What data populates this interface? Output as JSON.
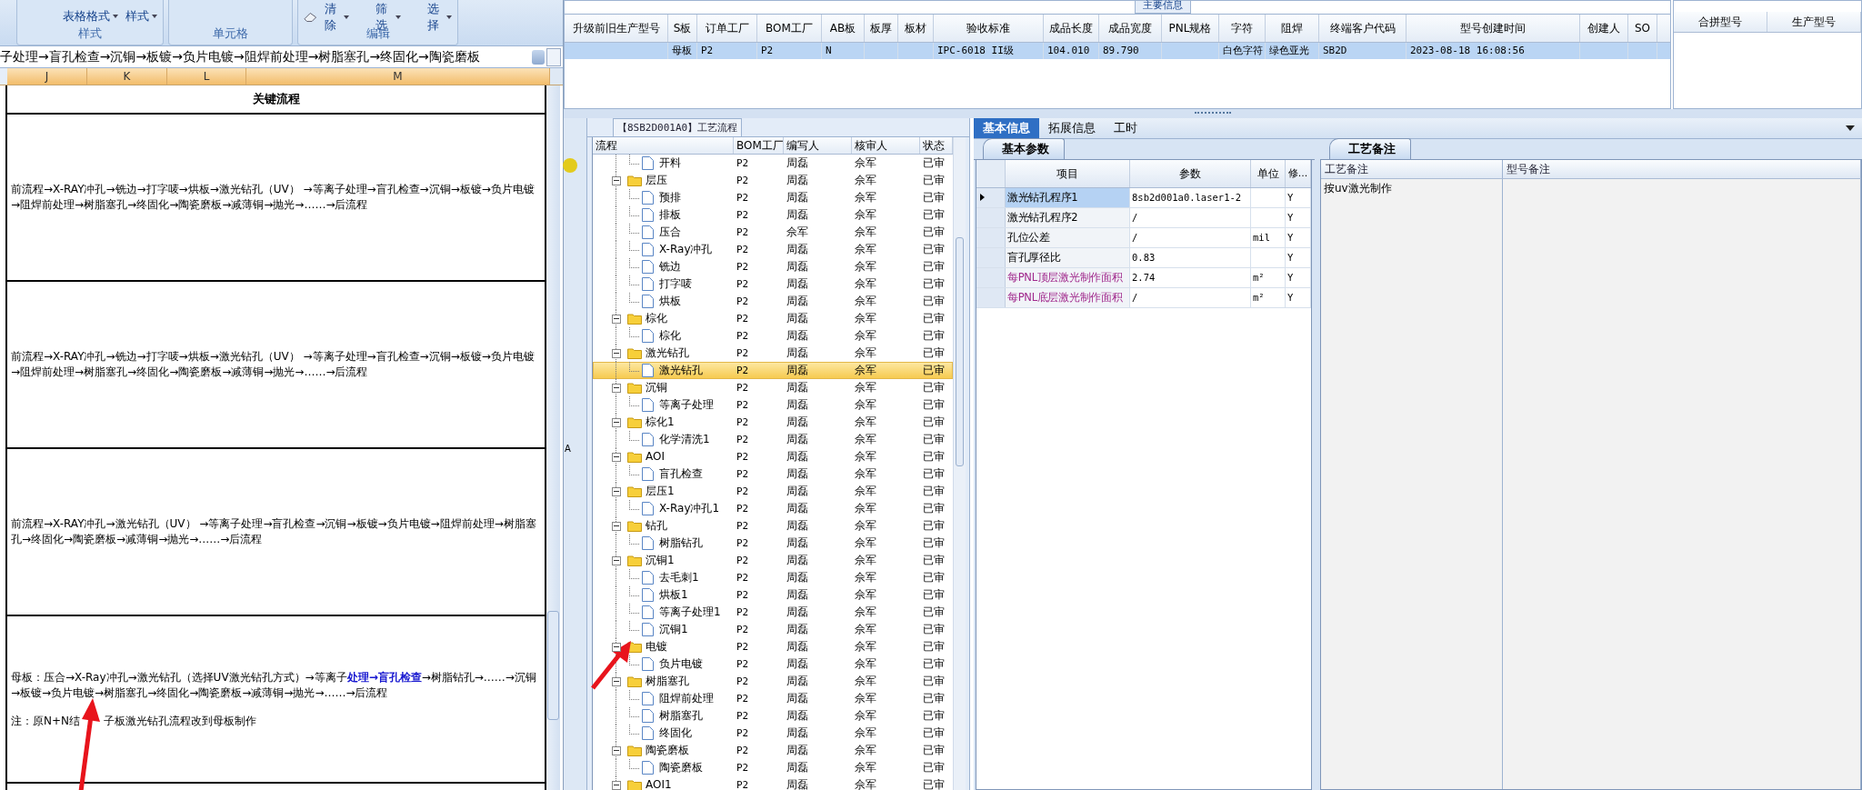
{
  "ribbon": {
    "groups": [
      {
        "label": "样式",
        "buttons": [
          {
            "label": "表格格式",
            "kind": "dropdown"
          },
          {
            "label": "样式",
            "kind": "dropdown"
          }
        ]
      },
      {
        "label": "单元格"
      },
      {
        "label": "编辑",
        "buttons": [
          {
            "label": "清除",
            "kind": "eraser"
          },
          {
            "label": "筛选",
            "kind": "dropdown"
          },
          {
            "label": "选择",
            "kind": "dropdown"
          }
        ]
      }
    ]
  },
  "formula_bar": {
    "value": "子处理→盲孔检查→沉铜→板镀→负片电镀→阻焊前处理→树脂塞孔→终固化→陶瓷磨板"
  },
  "sheet": {
    "columns": [
      {
        "label": "J",
        "selected": true
      },
      {
        "label": "K",
        "selected": true
      },
      {
        "label": "L",
        "selected": true
      },
      {
        "label": "M",
        "selected": true
      }
    ],
    "header": "关键流程",
    "rows": [
      {
        "text": "前流程→X-RAY冲孔→铣边→打字唛→烘板→激光钻孔（UV） →等离子处理→盲孔检查→沉铜→板镀→负片电镀→阻焊前处理→树脂塞孔→终固化→陶瓷磨板→减薄铜→抛光→……→后流程"
      },
      {
        "text": "前流程→X-RAY冲孔→铣边→打字唛→烘板→激光钻孔（UV） →等离子处理→盲孔检查→沉铜→板镀→负片电镀→阻焊前处理→树脂塞孔→终固化→陶瓷磨板→减薄铜→抛光→……→后流程"
      },
      {
        "text": "前流程→X-RAY冲孔→激光钻孔（UV） →等离子处理→盲孔检查→沉铜→板镀→负片电镀→阻焊前处理→树脂塞孔→终固化→陶瓷磨板→减薄铜→抛光→……→后流程"
      },
      {
        "text": "母板：压合→X-Ray冲孔→激光钻孔（选择UV激光钻孔方式）→等离子**处理→盲孔检查**→树脂钻孔→……→沉铜→板镀→负片电镀→树脂塞孔→终固化→陶瓷磨板→减薄铜→抛光→……→后流程",
        "note": [
          "注：原N+N结",
          "子板激光钻孔流程改到母板制作"
        ]
      }
    ]
  },
  "side_strip": {
    "label": "A"
  },
  "main_info": {
    "title": "主要信息",
    "selected": true,
    "columns": [
      {
        "label": "升级前旧生产型号"
      },
      {
        "label": "S板",
        "value": "母板"
      },
      {
        "label": "订单工厂",
        "value": "P2"
      },
      {
        "label": "BOM工厂",
        "value": "P2"
      },
      {
        "label": "AB板",
        "value": "N"
      },
      {
        "label": "板厚"
      },
      {
        "label": "板材"
      },
      {
        "label": "验收标准",
        "value": "IPC-6018 II级"
      },
      {
        "label": "成品长度",
        "value": "104.010"
      },
      {
        "label": "成品宽度",
        "value": "89.790"
      },
      {
        "label": "PNL规格"
      },
      {
        "label": "字符",
        "value": "白色字符"
      },
      {
        "label": "阻焊",
        "value": "绿色亚光"
      },
      {
        "label": "终端客户代码",
        "value": "SB2D"
      },
      {
        "label": "型号创建时间",
        "value": "2023-08-18 16:08:56"
      },
      {
        "label": "创建人"
      },
      {
        "label": "SO"
      }
    ]
  },
  "merge_grid": {
    "columns": [
      "合拼型号",
      "生产型号"
    ]
  },
  "process": {
    "title": "【8SB2D001A0】工艺流程",
    "columns": [
      "流程",
      "BOM工厂",
      "编写人",
      "核审人",
      "状态"
    ],
    "tree": [
      {
        "kind": "continuation",
        "children": [
          {
            "kind": "file",
            "label": "开料",
            "bom": "P2",
            "writer": "周磊",
            "reviewer": "佘军",
            "status": "已审",
            "selected": false
          }
        ]
      },
      {
        "kind": "folder",
        "label": "层压",
        "bom": "P2",
        "writer": "周磊",
        "reviewer": "佘军",
        "status": "已审",
        "selected": false,
        "expanded": true,
        "children": [
          {
            "kind": "file",
            "label": "预排",
            "bom": "P2",
            "writer": "周磊",
            "reviewer": "佘军",
            "status": "已审",
            "selected": false
          },
          {
            "kind": "file",
            "label": "排板",
            "bom": "P2",
            "writer": "周磊",
            "reviewer": "佘军",
            "status": "已审",
            "selected": false
          },
          {
            "kind": "file",
            "label": "压合",
            "bom": "P2",
            "writer": "佘军",
            "reviewer": "佘军",
            "status": "已审",
            "selected": false
          },
          {
            "kind": "file",
            "label": "X-Ray冲孔",
            "bom": "P2",
            "writer": "周磊",
            "reviewer": "佘军",
            "status": "已审",
            "selected": false
          },
          {
            "kind": "file",
            "label": "铣边",
            "bom": "P2",
            "writer": "周磊",
            "reviewer": "佘军",
            "status": "已审",
            "selected": false
          },
          {
            "kind": "file",
            "label": "打字唛",
            "bom": "P2",
            "writer": "周磊",
            "reviewer": "佘军",
            "status": "已审",
            "selected": false
          },
          {
            "kind": "file",
            "label": "烘板",
            "bom": "P2",
            "writer": "周磊",
            "reviewer": "佘军",
            "status": "已审",
            "selected": false
          }
        ]
      },
      {
        "kind": "folder",
        "label": "棕化",
        "bom": "P2",
        "writer": "周磊",
        "reviewer": "佘军",
        "status": "已审",
        "selected": false,
        "expanded": true,
        "children": [
          {
            "kind": "file",
            "label": "棕化",
            "bom": "P2",
            "writer": "周磊",
            "reviewer": "佘军",
            "status": "已审",
            "selected": false
          }
        ]
      },
      {
        "kind": "folder",
        "label": "激光钻孔",
        "bom": "P2",
        "writer": "周磊",
        "reviewer": "佘军",
        "status": "已审",
        "selected": false,
        "expanded": true,
        "children": [
          {
            "kind": "file",
            "label": "激光钻孔",
            "bom": "P2",
            "writer": "周磊",
            "reviewer": "佘军",
            "status": "已审",
            "selected": true
          }
        ]
      },
      {
        "kind": "folder",
        "label": "沉铜",
        "bom": "P2",
        "writer": "周磊",
        "reviewer": "佘军",
        "status": "已审",
        "selected": false,
        "expanded": true,
        "children": [
          {
            "kind": "file",
            "label": "等离子处理",
            "bom": "P2",
            "writer": "周磊",
            "reviewer": "佘军",
            "status": "已审",
            "selected": false
          }
        ]
      },
      {
        "kind": "folder",
        "label": "棕化1",
        "bom": "P2",
        "writer": "周磊",
        "reviewer": "佘军",
        "status": "已审",
        "selected": false,
        "expanded": true,
        "children": [
          {
            "kind": "file",
            "label": "化学清洗1",
            "bom": "P2",
            "writer": "周磊",
            "reviewer": "佘军",
            "status": "已审",
            "selected": false
          }
        ]
      },
      {
        "kind": "folder",
        "label": "AOI",
        "bom": "P2",
        "writer": "周磊",
        "reviewer": "佘军",
        "status": "已审",
        "selected": false,
        "expanded": true,
        "children": [
          {
            "kind": "file",
            "label": "盲孔检查",
            "bom": "P2",
            "writer": "周磊",
            "reviewer": "佘军",
            "status": "已审",
            "selected": false
          }
        ]
      },
      {
        "kind": "folder",
        "label": "层压1",
        "bom": "P2",
        "writer": "周磊",
        "reviewer": "佘军",
        "status": "已审",
        "selected": false,
        "expanded": true,
        "children": [
          {
            "kind": "file",
            "label": "X-Ray冲孔1",
            "bom": "P2",
            "writer": "周磊",
            "reviewer": "佘军",
            "status": "已审",
            "selected": false
          }
        ]
      },
      {
        "kind": "folder",
        "label": "钻孔",
        "bom": "P2",
        "writer": "周磊",
        "reviewer": "佘军",
        "status": "已审",
        "selected": false,
        "expanded": true,
        "children": [
          {
            "kind": "file",
            "label": "树脂钻孔",
            "bom": "P2",
            "writer": "周磊",
            "reviewer": "佘军",
            "status": "已审",
            "selected": false
          }
        ]
      },
      {
        "kind": "folder",
        "label": "沉铜1",
        "bom": "P2",
        "writer": "周磊",
        "reviewer": "佘军",
        "status": "已审",
        "selected": false,
        "expanded": true,
        "children": [
          {
            "kind": "file",
            "label": "去毛刺1",
            "bom": "P2",
            "writer": "周磊",
            "reviewer": "佘军",
            "status": "已审",
            "selected": false
          },
          {
            "kind": "file",
            "label": "烘板1",
            "bom": "P2",
            "writer": "周磊",
            "reviewer": "佘军",
            "status": "已审",
            "selected": false
          },
          {
            "kind": "file",
            "label": "等离子处理1",
            "bom": "P2",
            "writer": "周磊",
            "reviewer": "佘军",
            "status": "已审",
            "selected": false
          },
          {
            "kind": "file",
            "label": "沉铜1",
            "bom": "P2",
            "writer": "周磊",
            "reviewer": "佘军",
            "status": "已审",
            "selected": false
          }
        ]
      },
      {
        "kind": "folder",
        "label": "电镀",
        "bom": "P2",
        "writer": "周磊",
        "reviewer": "佘军",
        "status": "已审",
        "selected": false,
        "expanded": true,
        "children": [
          {
            "kind": "file",
            "label": "负片电镀",
            "bom": "P2",
            "writer": "周磊",
            "reviewer": "佘军",
            "status": "已审",
            "selected": false
          }
        ]
      },
      {
        "kind": "folder",
        "label": "树脂塞孔",
        "bom": "P2",
        "writer": "周磊",
        "reviewer": "佘军",
        "status": "已审",
        "selected": false,
        "expanded": true,
        "children": [
          {
            "kind": "file",
            "label": "阻焊前处理",
            "bom": "P2",
            "writer": "周磊",
            "reviewer": "佘军",
            "status": "已审",
            "selected": false
          },
          {
            "kind": "file",
            "label": "树脂塞孔",
            "bom": "P2",
            "writer": "周磊",
            "reviewer": "佘军",
            "status": "已审",
            "selected": false
          },
          {
            "kind": "file",
            "label": "终固化",
            "bom": "P2",
            "writer": "周磊",
            "reviewer": "佘军",
            "status": "已审",
            "selected": false
          }
        ]
      },
      {
        "kind": "folder",
        "label": "陶瓷磨板",
        "bom": "P2",
        "writer": "周磊",
        "reviewer": "佘军",
        "status": "已审",
        "selected": false,
        "expanded": true,
        "children": [
          {
            "kind": "file",
            "label": "陶瓷磨板",
            "bom": "P2",
            "writer": "周磊",
            "reviewer": "佘军",
            "status": "已审",
            "selected": false
          }
        ]
      },
      {
        "kind": "folder",
        "label": "AOI1",
        "bom": "P2",
        "writer": "周磊",
        "reviewer": "佘军",
        "status": "已审",
        "selected": false,
        "expanded": true
      }
    ]
  },
  "detail": {
    "tabs": [
      {
        "label": "基本信息",
        "selected": true
      },
      {
        "label": "拓展信息",
        "selected": false
      },
      {
        "label": "工时",
        "selected": false
      }
    ],
    "params": {
      "title": "基本参数",
      "columns": [
        "项目",
        "参数",
        "单位",
        "修..."
      ],
      "rows": [
        {
          "name": "激光钻孔程序1",
          "value": "8sb2d001a0.laser1-2",
          "flag": "Y",
          "selected": true
        },
        {
          "name": "激光钻孔程序2",
          "value": "/",
          "flag": "Y",
          "selected": false
        },
        {
          "name": "孔位公差",
          "value": "/",
          "unit": "mil",
          "flag": "Y",
          "selected": false
        },
        {
          "name": "盲孔厚径比",
          "value": "0.83",
          "flag": "Y",
          "selected": false
        },
        {
          "name": "每PNL顶层激光制作面积",
          "value": "2.74",
          "unit": "m²",
          "flag": "Y",
          "selected": false,
          "color": "#a0288c"
        },
        {
          "name": "每PNL底层激光制作面积",
          "value": "/",
          "unit": "m²",
          "flag": "Y",
          "selected": false,
          "color": "#a0288c"
        }
      ]
    },
    "remarks": {
      "title": "工艺备注",
      "columns": [
        "工艺备注",
        "型号备注"
      ],
      "process_note": "按uv激光制作"
    }
  }
}
